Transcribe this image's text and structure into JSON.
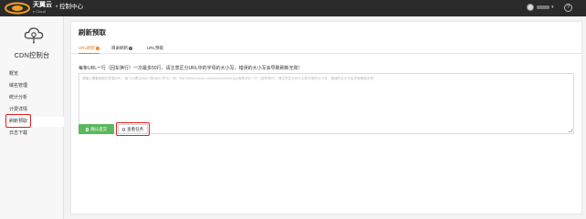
{
  "header": {
    "brand": "天翼云",
    "brand_sub": "e Cloud",
    "separator": "•",
    "title": "控制中心",
    "help": "?"
  },
  "sidebar": {
    "title": "CDN控制台",
    "items": [
      {
        "label": "概览"
      },
      {
        "label": "域名管理"
      },
      {
        "label": "统计分析"
      },
      {
        "label": "计费详情"
      },
      {
        "label": "刷新预取"
      },
      {
        "label": "日志下载"
      }
    ],
    "active_index": 4
  },
  "main": {
    "page_title": "刷新预取",
    "tabs": [
      {
        "label": "URL刷新",
        "help": "?"
      },
      {
        "label": "目录刷新",
        "help": "?"
      },
      {
        "label": "URL预取",
        "help": ""
      }
    ],
    "active_tab": 0,
    "note": "每条URL一行（回车换行）一次最多50行，请注意区分URL中的字母的大小写，错误的大小写会导致刷新无效！",
    "textarea_placeholder": "请输入需要刷新的完整URL，每个url要以http://或https://开头，例：http://www.xxxxxx.com/xxx/xxxx/test.jpg 每条URL一行（回车换行） 请注意区分URL中的字母的大小写，错误的大小写会导致刷新无效！",
    "submit_label": "确认提交",
    "query_label": "查看任务"
  },
  "colors": {
    "accent": "#f0781e",
    "topbar": "#2a2a2a",
    "submit": "#5cb85c",
    "highlight": "#e02020"
  }
}
